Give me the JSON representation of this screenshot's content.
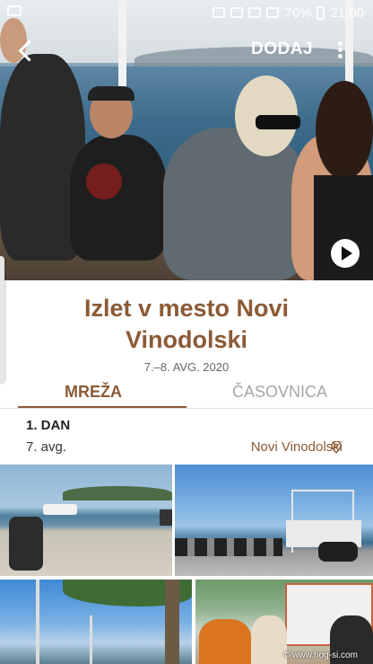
{
  "status_bar": {
    "battery": "70%",
    "time": "21:00"
  },
  "header": {
    "add_label": "DODAJ"
  },
  "trip": {
    "title": "Izlet v mesto Novi Vinodolski",
    "dates": "7.–8. AVG. 2020"
  },
  "tabs": [
    {
      "label": "MREŽA",
      "active": true
    },
    {
      "label": "ČASOVNICA",
      "active": false
    }
  ],
  "day": {
    "title": "1. DAN",
    "date": "7. avg.",
    "location": "Novi Vinodolski"
  },
  "photos": [
    {
      "id": 1
    },
    {
      "id": 2
    },
    {
      "id": 3
    },
    {
      "id": 4
    }
  ],
  "watermark": "© www.hog-si.com",
  "colors": {
    "accent": "#8b5a35",
    "inactive_tab": "#a7a7a7"
  },
  "icons": [
    "mail-icon",
    "alarm-icon",
    "vibrate-icon",
    "wifi-icon",
    "signal-icon",
    "battery-icon",
    "back-arrow-icon",
    "more-vert-icon",
    "play-icon",
    "location-pin-icon"
  ]
}
